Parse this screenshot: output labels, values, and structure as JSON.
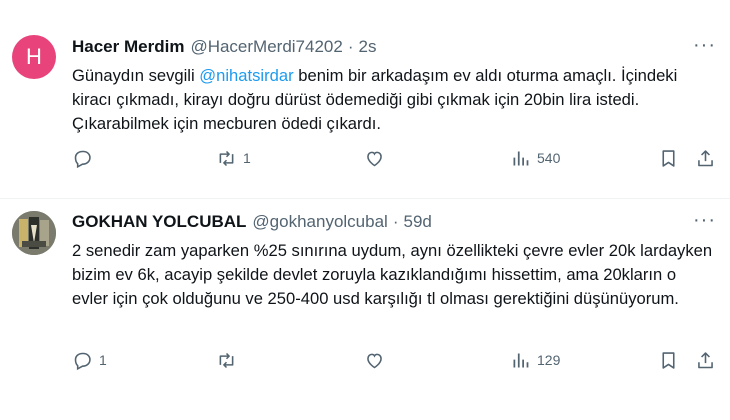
{
  "tweets": [
    {
      "avatar_letter": "H",
      "name": "Hacer Merdim",
      "handle": "@HacerMerdi74202",
      "time": "2s",
      "text_before": "Günaydın sevgili ",
      "mention": "@nihatsirdar",
      "text_after": " benim bir arkadaşım ev aldı oturma amaçlı. İçindeki kiracı çıkmadı, kirayı doğru dürüst ödemediği gibi çıkmak için 20bin lira istedi. Çıkarabilmek için mecburen ödedi çıkardı.",
      "replies": "",
      "retweets": "1",
      "likes": "",
      "views": "540"
    },
    {
      "avatar_letter": "",
      "name": "GOKHAN YOLCUBAL",
      "handle": "@gokhanyolcubal",
      "time": "59d",
      "text_before": "2 senedir zam yaparken %25 sınırına uydum, aynı özellikteki çevre evler 20k lardayken bizim ev 6k, acayip şekilde devlet zoruyla kazıklandığımı hissettim, ama 20kların o evler için çok olduğunu ve 250-400 usd karşılığı tl olması gerektiğini düşünüyorum.",
      "mention": "",
      "text_after": "",
      "replies": "1",
      "retweets": "",
      "likes": "",
      "views": "129"
    }
  ],
  "ui": {
    "dot": "·",
    "more": "···"
  },
  "colors": {
    "text": "#0f1419",
    "muted": "#536471",
    "link": "#1d9bf0",
    "avatar": "#e8437a",
    "divider": "#eff3f4"
  },
  "icons": [
    "more-icon",
    "reply-icon",
    "retweet-icon",
    "like-icon",
    "views-icon",
    "bookmark-icon",
    "share-icon"
  ]
}
